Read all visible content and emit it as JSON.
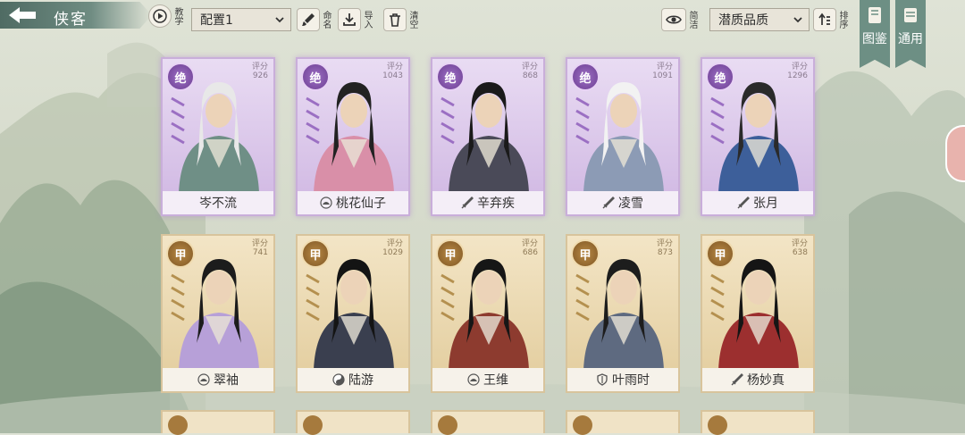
{
  "header": {
    "title": "侠客",
    "tutorial_label": "教学",
    "preset_select": "配置1",
    "rename_label": "命名",
    "import_label": "导入",
    "clear_label": "清空",
    "simple_label": "简洁",
    "sort_select": "潜质品质",
    "sort_label": "排序",
    "gallery_label": "图鉴",
    "general_label": "通用"
  },
  "score_label": "评分",
  "cards": [
    {
      "grade": "绝",
      "score": "926",
      "name": "岑不流",
      "tier": "purple",
      "emblem": ""
    },
    {
      "grade": "绝",
      "score": "1043",
      "name": "桃花仙子",
      "tier": "purple",
      "emblem": "lotus-icon"
    },
    {
      "grade": "绝",
      "score": "868",
      "name": "辛弃疾",
      "tier": "purple",
      "emblem": "sword-icon"
    },
    {
      "grade": "绝",
      "score": "1091",
      "name": "凌雪",
      "tier": "purple",
      "emblem": "sword-icon"
    },
    {
      "grade": "绝",
      "score": "1296",
      "name": "张月",
      "tier": "purple",
      "emblem": "sword-icon"
    },
    {
      "grade": "甲",
      "score": "741",
      "name": "翠袖",
      "tier": "gold",
      "emblem": "lotus-icon"
    },
    {
      "grade": "甲",
      "score": "1029",
      "name": "陆游",
      "tier": "gold",
      "emblem": "taiji-icon"
    },
    {
      "grade": "甲",
      "score": "686",
      "name": "王维",
      "tier": "gold",
      "emblem": "lotus-icon"
    },
    {
      "grade": "甲",
      "score": "873",
      "name": "叶雨时",
      "tier": "gold",
      "emblem": "shield-icon"
    },
    {
      "grade": "甲",
      "score": "638",
      "name": "杨妙真",
      "tier": "gold",
      "emblem": "sword-icon"
    }
  ],
  "colors": {
    "purple_tier": "#c9aeda",
    "gold_tier": "#d8c49c",
    "accent_green": "#6d8f84"
  }
}
